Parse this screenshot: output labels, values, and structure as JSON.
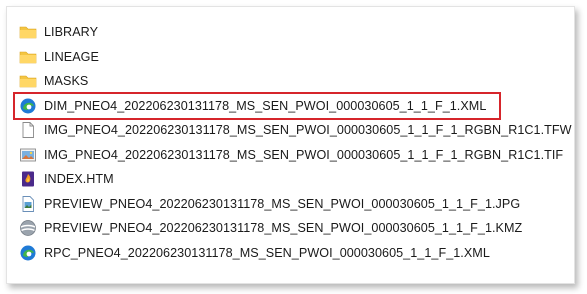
{
  "colors": {
    "folder": "#f4c542",
    "highlight_border": "#d6252b",
    "edge_blue": "#1f7ad6",
    "edge_green": "#41b64a"
  },
  "files": [
    {
      "name": "LIBRARY",
      "icon": "folder-icon"
    },
    {
      "name": "LINEAGE",
      "icon": "folder-icon"
    },
    {
      "name": "MASKS",
      "icon": "folder-icon"
    },
    {
      "name": "DIM_PNEO4_202206230131178_MS_SEN_PWOI_000030605_1_1_F_1.XML",
      "icon": "edge-xml-icon",
      "highlighted": true
    },
    {
      "name": "IMG_PNEO4_202206230131178_MS_SEN_PWOI_000030605_1_1_F_1_RGBN_R1C1.TFW",
      "icon": "text-file-icon"
    },
    {
      "name": "IMG_PNEO4_202206230131178_MS_SEN_PWOI_000030605_1_1_F_1_RGBN_R1C1.TIF",
      "icon": "image-file-icon"
    },
    {
      "name": "INDEX.HTM",
      "icon": "html-file-icon"
    },
    {
      "name": "PREVIEW_PNEO4_202206230131178_MS_SEN_PWOI_000030605_1_1_F_1.JPG",
      "icon": "jpg-file-icon"
    },
    {
      "name": "PREVIEW_PNEO4_202206230131178_MS_SEN_PWOI_000030605_1_1_F_1.KMZ",
      "icon": "kmz-globe-icon"
    },
    {
      "name": "RPC_PNEO4_202206230131178_MS_SEN_PWOI_000030605_1_1_F_1.XML",
      "icon": "edge-xml-icon"
    }
  ]
}
